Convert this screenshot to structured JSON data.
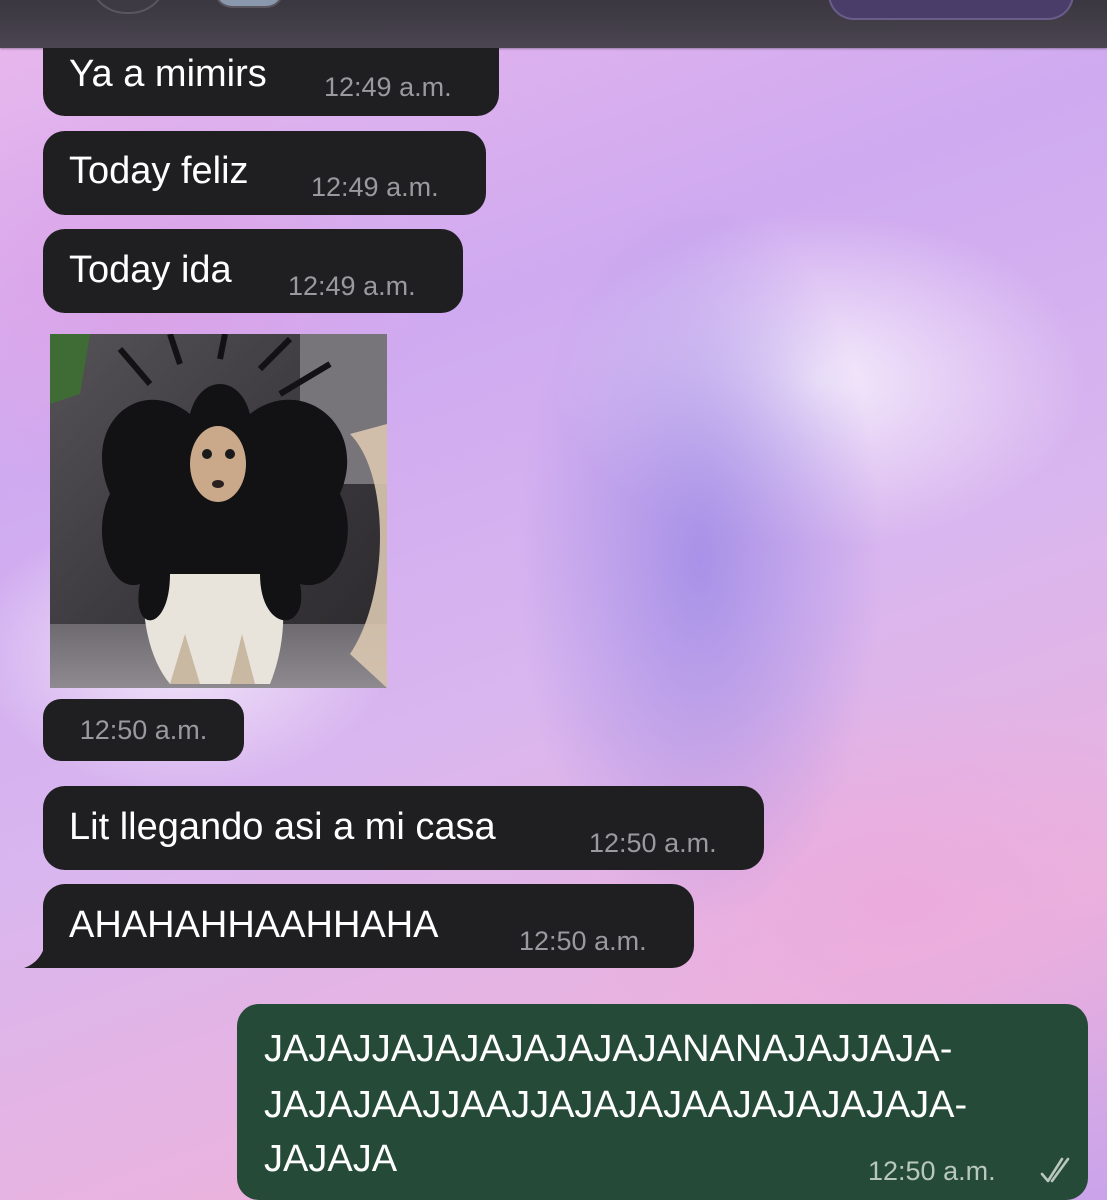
{
  "messages": [
    {
      "text": "Ya a mimirs",
      "time": "12:49 a.m."
    },
    {
      "text": "Today feliz",
      "time": "12:49 a.m."
    },
    {
      "text": "Today ida",
      "time": "12:49 a.m."
    },
    {
      "text": "",
      "time": "12:50 a.m."
    },
    {
      "text": "Lit llegando asi a mi casa",
      "time": "12:50 a.m."
    },
    {
      "text": "AHAHAHHAAHHAHA",
      "time": "12:50 a.m."
    }
  ],
  "outgoing": {
    "lines": [
      "JAJAJJAJAJAJAJAJAJANANAJAJJAJA-",
      "JAJAJAAJJAAJJAJAJAJAAJAJAJAJAJA-",
      "JAJAJA"
    ],
    "time": "12:50 a.m.",
    "status_icon": "double-check-icon"
  },
  "colors": {
    "incoming_bubble": "#1f1f21",
    "outgoing_bubble": "#264a38",
    "timestamp": "#9a9a9e"
  }
}
